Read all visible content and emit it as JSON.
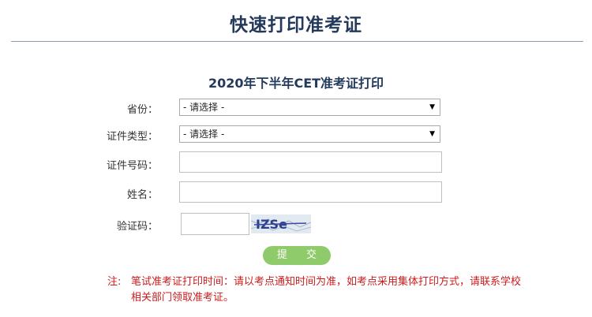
{
  "page": {
    "title": "快速打印准考证"
  },
  "form": {
    "title": "2020年下半年CET准考证打印",
    "province": {
      "label": "省份：",
      "value": "- 请选择 -"
    },
    "id_type": {
      "label": "证件类型：",
      "value": "- 请选择 -"
    },
    "id_number": {
      "label": "证件号码：",
      "value": ""
    },
    "name": {
      "label": "姓名：",
      "value": ""
    },
    "captcha": {
      "label": "验证码：",
      "value": "",
      "image_text": "IZSe"
    },
    "submit_label": "提 交"
  },
  "note": {
    "label": "注:",
    "text": "笔试准考证打印时间：请以考点通知时间为准，如考点采用集体打印方式，请联系学校相关部门领取准考证。"
  },
  "colors": {
    "title": "#233a5c",
    "button": "#8fcb6a",
    "note": "#cc1b1b"
  },
  "icons": {
    "select_arrow": "dropdown-arrow-icon"
  }
}
